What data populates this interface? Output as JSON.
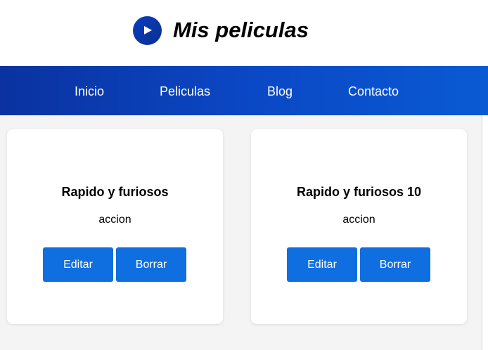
{
  "header": {
    "title": "Mis peliculas",
    "logo_icon": "play-icon"
  },
  "nav": {
    "items": [
      {
        "label": "Inicio"
      },
      {
        "label": "Peliculas"
      },
      {
        "label": "Blog"
      },
      {
        "label": "Contacto"
      }
    ]
  },
  "movies": [
    {
      "title": "Rapido y furiosos",
      "genre": "accion",
      "edit_label": "Editar",
      "delete_label": "Borrar"
    },
    {
      "title": "Rapido y furiosos 10",
      "genre": "accion",
      "edit_label": "Editar",
      "delete_label": "Borrar"
    }
  ],
  "colors": {
    "nav_start": "#0a32a0",
    "nav_end": "#0a5ad4",
    "button": "#0f6fe0"
  }
}
